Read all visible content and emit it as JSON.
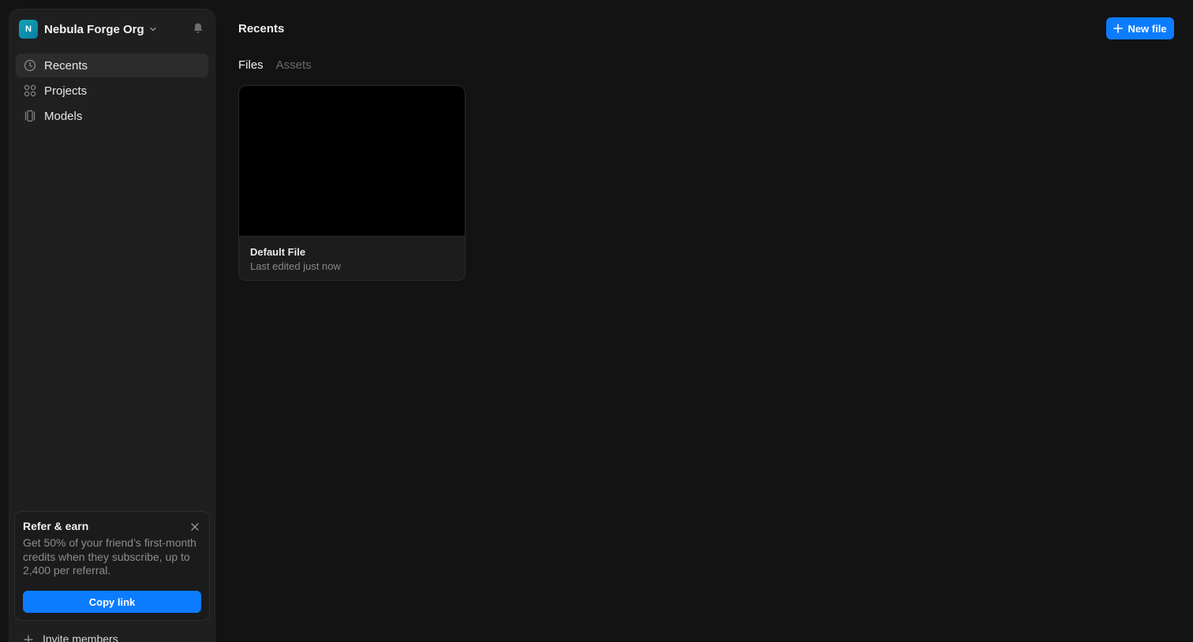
{
  "sidebar": {
    "org": {
      "initial": "N",
      "name": "Nebula Forge Org"
    },
    "nav": [
      {
        "label": "Recents",
        "icon": "clock-icon",
        "active": true
      },
      {
        "label": "Projects",
        "icon": "grid-icon",
        "active": false
      },
      {
        "label": "Models",
        "icon": "models-icon",
        "active": false
      }
    ],
    "promo": {
      "title": "Refer & earn",
      "text": "Get 50% of your friend’s first-month credits when they subscribe, up to 2,400 per referral.",
      "button": "Copy link"
    },
    "invite_label": "Invite members"
  },
  "header": {
    "title": "Recents",
    "new_file_label": "New file"
  },
  "tabs": [
    {
      "label": "Files",
      "active": true
    },
    {
      "label": "Assets",
      "active": false
    }
  ],
  "files": [
    {
      "name": "Default File",
      "meta": "Last edited just now"
    }
  ],
  "colors": {
    "accent": "#0c7cff",
    "background": "#131313",
    "sidebar": "#1f1f1f",
    "org_avatar": "#0fa3b8"
  }
}
